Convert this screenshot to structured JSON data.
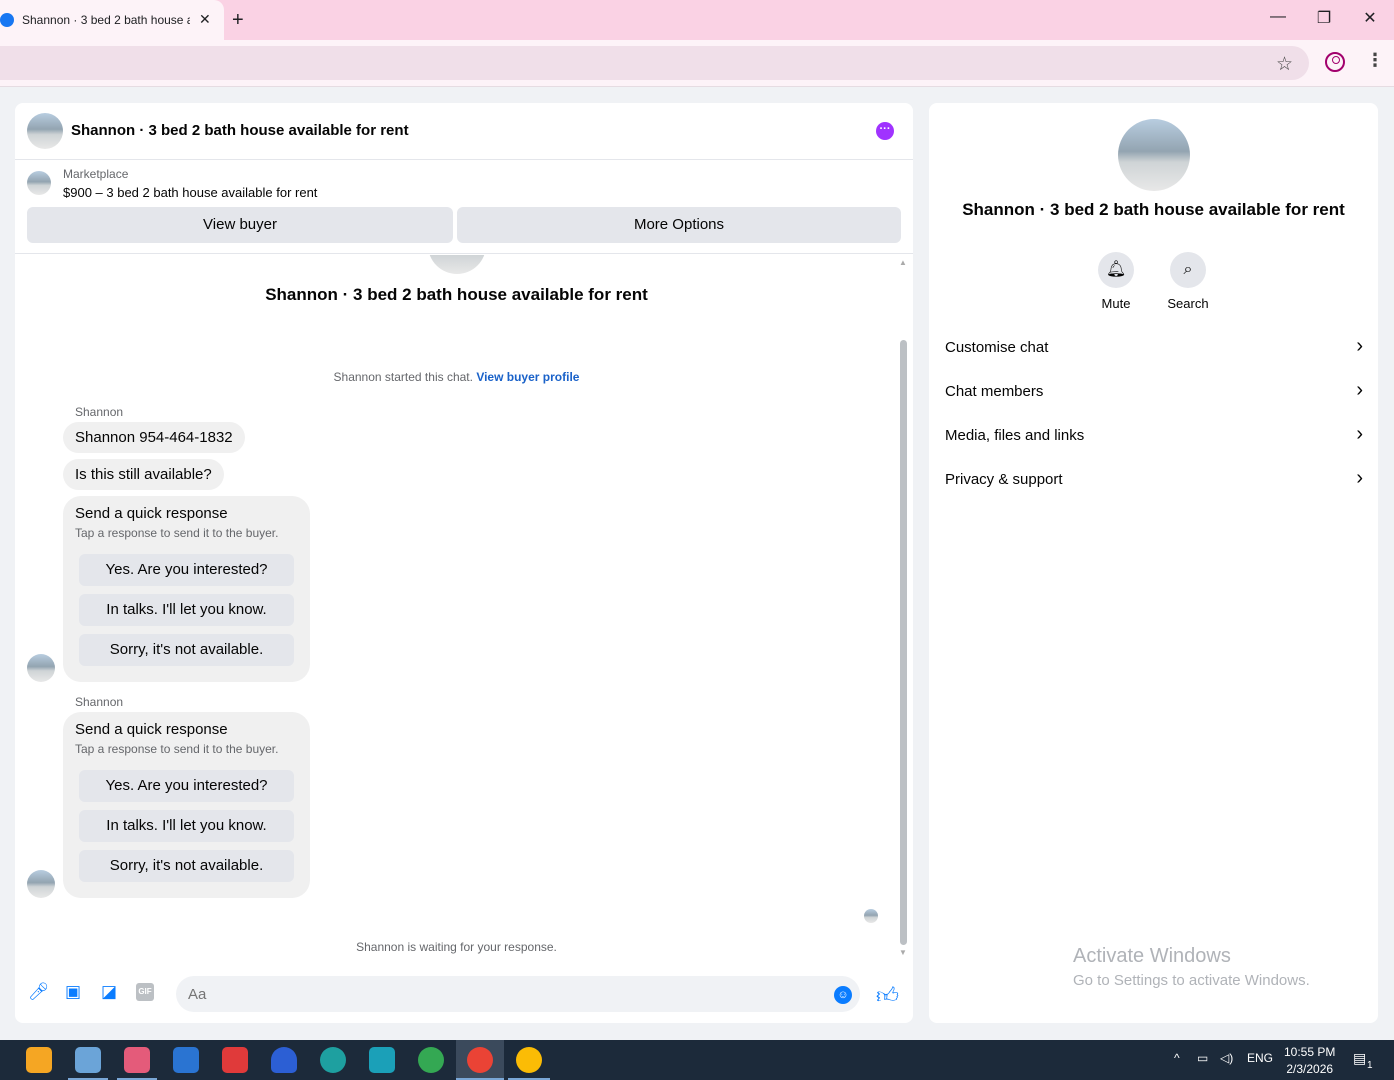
{
  "browser": {
    "tab_title": "Shannon · 3 bed 2 bath house a",
    "close": "✕",
    "new_tab": "+",
    "minimize": "—",
    "restore": "❐",
    "close_window": "✕"
  },
  "chat": {
    "header_title": "Shannon · 3 bed 2 bath house available for rent",
    "listing_label": "Marketplace",
    "listing_price": "$900 – 3 bed 2 bath house available for rent",
    "view_buyer": "View buyer",
    "more_options": "More Options",
    "convo_title": "Shannon · 3 bed 2 bath house available for rent",
    "started_text": "Shannon started this chat.",
    "started_link": "View buyer profile",
    "messages": [
      {
        "sender": "Shannon",
        "text": "Shannon 954-464-1832"
      },
      {
        "text": "Is this still available?"
      }
    ],
    "quick_responses": [
      {
        "title": "Send a quick response",
        "subtitle": "Tap a response to send it to the buyer.",
        "options": [
          "Yes. Are you interested?",
          "In talks. I'll let you know.",
          "Sorry, it's not available."
        ]
      },
      {
        "sender": "Shannon",
        "title": "Send a quick response",
        "subtitle": "Tap a response to send it to the buyer.",
        "options": [
          "Yes. Are you interested?",
          "In talks. I'll let you know.",
          "Sorry, it's not available."
        ]
      }
    ],
    "waiting": "Shannon is waiting for your response.",
    "composer_placeholder": "Aa",
    "gif": "GIF"
  },
  "info": {
    "title": "Shannon · 3 bed 2 bath house available for rent",
    "mute": "Mute",
    "search": "Search",
    "menu": [
      "Customise chat",
      "Chat members",
      "Media, files and links",
      "Privacy & support"
    ],
    "activate_title": "Activate Windows",
    "activate_sub": "Go to Settings to activate Windows."
  },
  "taskbar": {
    "lang": "ENG",
    "time": "10:55 PM",
    "date": "2/3/2026",
    "notifications": "1"
  },
  "colors": {
    "accent": "#0a7cff",
    "link": "#1a62c9",
    "tab_bar": "#fad2e4"
  }
}
